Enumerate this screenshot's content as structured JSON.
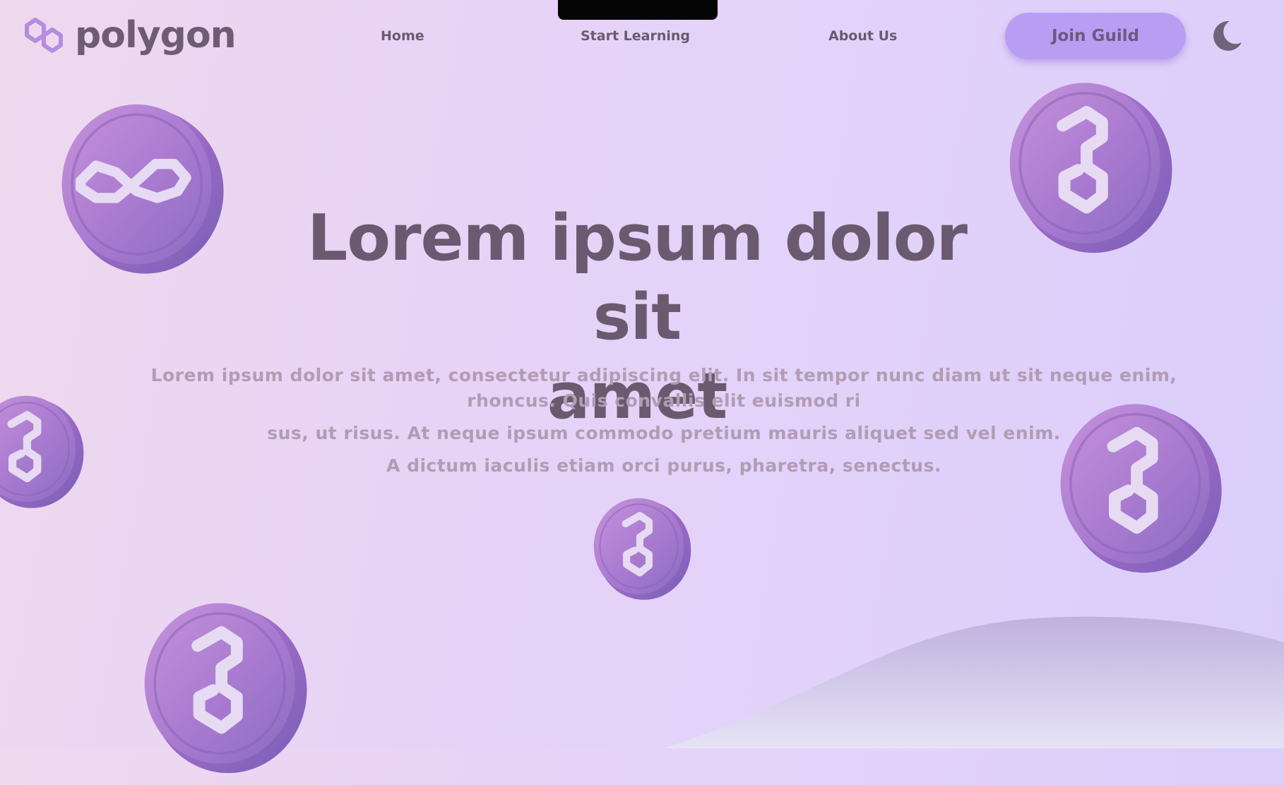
{
  "brand": {
    "name": "polygon",
    "icon": "polygon-logo-icon"
  },
  "nav": {
    "home": "Home",
    "start_learning": "Start Learning",
    "about_us": "About Us",
    "join_label": "Join Guild",
    "theme_icon": "moon-icon"
  },
  "hero": {
    "title_line1": "Lorem ipsum dolor sit",
    "title_line2": "amet",
    "subtitle_line1": "Lorem ipsum dolor sit amet, consectetur adipiscing elit. In sit tempor nunc diam ut sit neque enim,",
    "subtitle_line2": "rhoncus. Quis convallis elit euismod ri",
    "subtitle_line3": "sus, ut risus. At neque ipsum commodo pretium mauris aliquet sed vel enim.",
    "subtitle_line4": "A dictum iaculis etiam orci purus, pharetra, senectus."
  },
  "decor": {
    "coin_icon": "polygon-coin-icon"
  },
  "colors": {
    "accent": "#b99df3",
    "text_dark": "#6b5a6f",
    "text_muted": "#b29cb3",
    "coin_purple": "#a273c9"
  }
}
